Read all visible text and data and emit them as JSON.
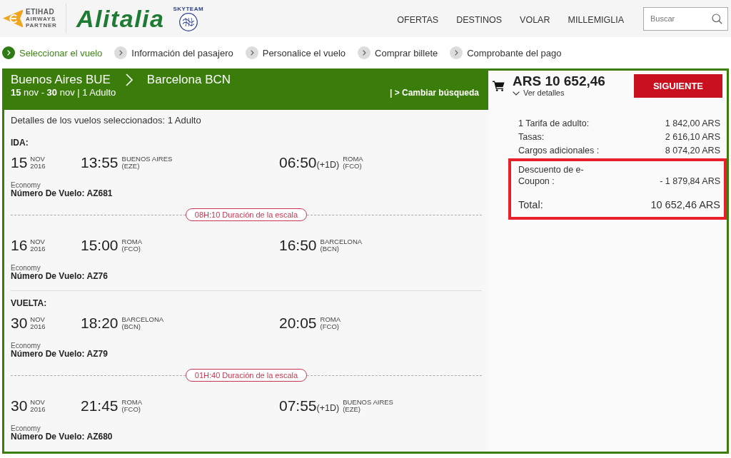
{
  "header": {
    "partner_logo": {
      "lines": [
        "ETIHAD",
        "AIRWAYS",
        "PARTNER"
      ]
    },
    "airline_logo": {
      "text": "Alitalia"
    },
    "alliance_logo": {
      "text": "SKYTEAM"
    },
    "nav": [
      {
        "label": "OFERTAS"
      },
      {
        "label": "DESTINOS"
      },
      {
        "label": "VOLAR"
      },
      {
        "label": "MILLEMIGLIA"
      }
    ],
    "search": {
      "placeholder": "Buscar"
    }
  },
  "steps": [
    {
      "label": "Seleccionar el vuelo",
      "selected": true
    },
    {
      "label": "Información del pasajero",
      "selected": false
    },
    {
      "label": "Personalice el vuelo",
      "selected": false
    },
    {
      "label": "Comprar billete",
      "selected": false
    },
    {
      "label": "Comprobante del pago",
      "selected": false
    }
  ],
  "trip": {
    "origin": "Buenos Aires BUE",
    "destination": "Barcelona BCN",
    "dates": "**15** nov - **30** nov | 1 Adulto",
    "change_link": "| > Cambiar búsqueda"
  },
  "details_title": "Detalles de los vuelos seleccionados: 1 Adulto",
  "journeys": [
    {
      "label": "IDA:",
      "items": [
        {
          "kind": "segment",
          "day": "15",
          "month": "NOV",
          "year": "2016",
          "departure_time": "13:55",
          "departure_city": "BUENOS AIRES",
          "departure_code": "(EZE)",
          "arrival_time": "06:50",
          "day_offset": "(+1D)",
          "arrival_city": "ROMA",
          "arrival_code": "(FCO)",
          "cabin": "Economy",
          "flight_number": "Número De Vuelo: AZ681"
        },
        {
          "kind": "layover",
          "text": "08H:10 Duración de la escala"
        },
        {
          "kind": "segment",
          "day": "16",
          "month": "NOV",
          "year": "2016",
          "departure_time": "15:00",
          "departure_city": "ROMA",
          "departure_code": "(FCO)",
          "arrival_time": "16:50",
          "arrival_city": "BARCELONA",
          "arrival_code": "(BCN)",
          "cabin": "Economy",
          "flight_number": "Número De Vuelo: AZ76"
        }
      ]
    },
    {
      "label": "VUELTA:",
      "items": [
        {
          "kind": "segment",
          "day": "30",
          "month": "NOV",
          "year": "2016",
          "departure_time": "18:20",
          "departure_city": "BARCELONA",
          "departure_code": "(BCN)",
          "arrival_time": "20:05",
          "arrival_city": "ROMA",
          "arrival_code": "(FCO)",
          "cabin": "Economy",
          "flight_number": "Número De Vuelo: AZ79"
        },
        {
          "kind": "layover",
          "text": "01H:40 Duración de la escala"
        },
        {
          "kind": "segment",
          "day": "30",
          "month": "NOV",
          "year": "2016",
          "departure_time": "21:45",
          "departure_city": "ROMA",
          "departure_code": "(FCO)",
          "arrival_time": "07:55",
          "day_offset": "(+1D)",
          "arrival_city": "BUENOS AIRES",
          "arrival_code": "(EZE)",
          "cabin": "Economy",
          "flight_number": "Número De Vuelo: AZ680"
        }
      ]
    }
  ],
  "summary": {
    "price": "ARS 10 652,46",
    "details_link": "Ver detalles",
    "next_button": "SIGUIENTE",
    "rows": [
      {
        "kind": "line",
        "label": "1 Tarifa de adulto:",
        "value": "1 842,00 ARS",
        "highlighted": false
      },
      {
        "kind": "line",
        "label": "Tasas:",
        "value": "2 616,10 ARS",
        "highlighted": false
      },
      {
        "kind": "line",
        "label": "Cargos adicionales :",
        "value": "8 074,20 ARS",
        "highlighted": false
      },
      {
        "kind": "line",
        "label": "Descuento de e-Coupon :",
        "value": "- 1 879,84 ARS",
        "highlighted": true
      },
      {
        "kind": "total",
        "label": "Total:",
        "value": "10 652,46 ARS",
        "highlighted": true
      }
    ]
  }
}
